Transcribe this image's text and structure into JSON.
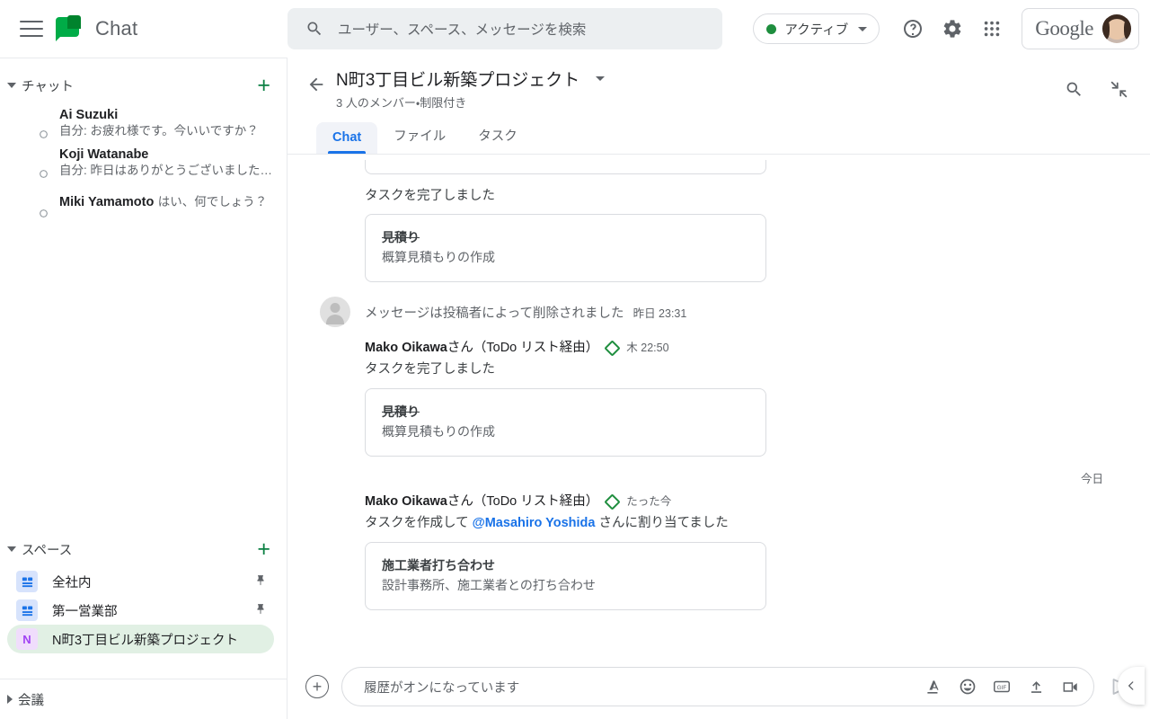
{
  "topbar": {
    "menu_icon": "hamburger-menu-icon",
    "app_name": "Chat",
    "search": {
      "icon": "search-icon",
      "placeholder": "ユーザー、スペース、メッセージを検索",
      "value": ""
    },
    "status": {
      "label": "アクティブ",
      "dot_color": "#1e8e3e"
    },
    "help_icon": "help-icon",
    "settings_icon": "gear-icon",
    "apps_icon": "apps-grid-icon",
    "google_label": "Google",
    "account_avatar": "user-avatar"
  },
  "sidebar": {
    "chat_section": {
      "title": "チャット",
      "add_label": "+"
    },
    "chats": [
      {
        "name": "Ai Suzuki",
        "snippet": "自分: お疲れ様です。今いいですか？"
      },
      {
        "name": "Koji Watanabe",
        "snippet": "自分: 昨日はありがとうございました…"
      },
      {
        "name": "Miki Yamamoto",
        "snippet": "はい、何でしょう？"
      }
    ],
    "spaces_section": {
      "title": "スペース",
      "add_label": "+"
    },
    "spaces": [
      {
        "name": "全社内",
        "icon": "group-icon",
        "initial": "",
        "pinned": true,
        "selected": false
      },
      {
        "name": "第一営業部",
        "icon": "group-icon",
        "initial": "",
        "pinned": true,
        "selected": false
      },
      {
        "name": "N町3丁目ビル新築プロジェクト",
        "icon": "letter-icon",
        "initial": "N",
        "pinned": false,
        "selected": true
      }
    ],
    "meet_section": {
      "title": "会議"
    }
  },
  "conversation": {
    "back_icon": "back-arrow-icon",
    "title": "N町3丁目ビル新築プロジェクト",
    "dropdown_icon": "chevron-down-icon",
    "subtitle": "3 人のメンバー・制限付き",
    "search_icon": "search-icon",
    "collapse_icon": "collapse-icon",
    "tabs": [
      {
        "label": "Chat",
        "active": true
      },
      {
        "label": "ファイル",
        "active": false
      },
      {
        "label": "タスク",
        "active": false
      }
    ]
  },
  "messages": {
    "top_partial_card": {
      "visible": true
    },
    "items": [
      {
        "type": "system_text",
        "text": "タスクを完了しました",
        "card": {
          "title": "見積り",
          "completed": true,
          "subtitle": "概算見積もりの作成"
        }
      },
      {
        "type": "deleted",
        "avatar": "ghost-avatar",
        "text": "メッセージは投稿者によって削除されました",
        "time": "昨日 23:31"
      },
      {
        "type": "message",
        "avatar": "user-avatar",
        "author_name": "Mako Oikawa",
        "author_suffix": "さん（ToDo リスト経由）",
        "badge_icon": "tasks-diamond-icon",
        "time": "木 22:50",
        "text": "タスクを完了しました",
        "card": {
          "title": "見積り",
          "completed": true,
          "subtitle": "概算見積もりの作成"
        }
      },
      {
        "type": "day_separator",
        "label": "今日"
      },
      {
        "type": "message",
        "avatar": "user-avatar",
        "author_name": "Mako Oikawa",
        "author_suffix": "さん（ToDo リスト経由）",
        "badge_icon": "tasks-diamond-icon",
        "time": "たった今",
        "text_before": "タスクを作成して ",
        "mention": "@Masahiro Yoshida",
        "text_after": " さんに割り当てました",
        "card": {
          "title": "施工業者打ち合わせ",
          "completed": false,
          "subtitle": "設計事務所、施工業者との打ち合わせ"
        }
      }
    ]
  },
  "composer": {
    "add_icon": "plus-circle-icon",
    "placeholder": "履歴がオンになっています",
    "value": "",
    "format_icon": "text-format-icon",
    "emoji_icon": "emoji-icon",
    "gif_icon": "gif-icon",
    "upload_icon": "upload-icon",
    "video_icon": "video-meeting-icon",
    "send_icon": "send-icon"
  },
  "collapse_fab": {
    "icon": "chevron-left-icon"
  },
  "colors": {
    "accent_blue": "#1a73e8",
    "green": "#1e8e3e",
    "selected_space_bg": "#e1f0e4",
    "search_bg": "#eceff1",
    "border": "#dadce0"
  }
}
